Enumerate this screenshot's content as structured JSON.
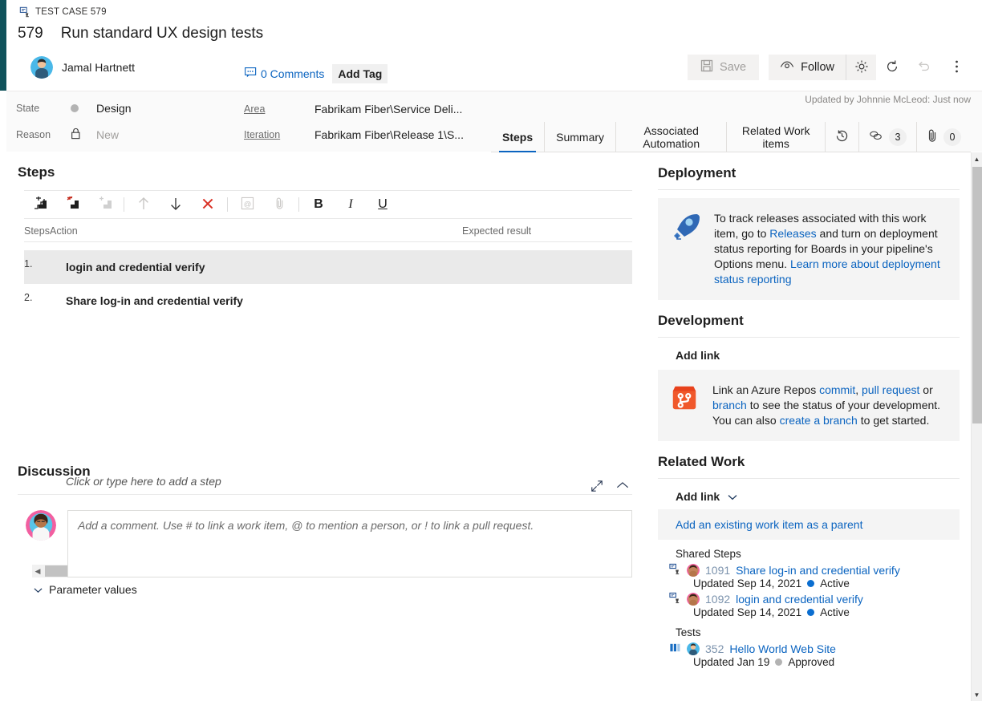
{
  "header": {
    "breadcrumb": "TEST CASE 579",
    "breadcrumb_icon": "test-case-icon",
    "work_item_id": "579",
    "work_item_title": "Run standard UX design tests",
    "assigned_to": "Jamal Hartnett",
    "comments_label": "0 Comments",
    "add_tag_label": "Add Tag",
    "save_label": "Save",
    "follow_label": "Follow",
    "updated_note": "Updated by Johnnie McLeod: Just now",
    "accent_color": "#10525b",
    "link_color": "#0b64c0"
  },
  "fields": {
    "state_label": "State",
    "state_value": "Design",
    "reason_label": "Reason",
    "reason_value": "New",
    "area_label": "Area",
    "area_value": "Fabrikam Fiber\\Service Deli...",
    "iteration_label": "Iteration",
    "iteration_value": "Fabrikam Fiber\\Release 1\\S..."
  },
  "tabs": {
    "items": [
      {
        "label": "Steps",
        "active": true
      },
      {
        "label": "Summary",
        "active": false
      },
      {
        "label": "Associated Automation",
        "active": false
      },
      {
        "label": "Related Work items",
        "active": false
      }
    ],
    "history_icon": "history-icon",
    "links_icon": "links-icon",
    "links_count": "3",
    "attachments_icon": "paperclip-icon",
    "attachments_count": "0"
  },
  "steps": {
    "title": "Steps",
    "toolbar": [
      {
        "name": "insert-step-icon",
        "enabled": true
      },
      {
        "name": "insert-shared-step-icon",
        "enabled": true
      },
      {
        "name": "insert-parameter-icon",
        "enabled": false
      },
      {
        "name": "move-up-icon",
        "enabled": false
      },
      {
        "name": "move-down-icon",
        "enabled": true
      },
      {
        "name": "delete-icon",
        "enabled": true
      },
      {
        "name": "mention-icon",
        "enabled": false
      },
      {
        "name": "attach-icon",
        "enabled": false
      },
      {
        "name": "bold-icon",
        "enabled": true
      },
      {
        "name": "italic-icon",
        "enabled": true
      },
      {
        "name": "underline-icon",
        "enabled": true
      }
    ],
    "bold_label": "B",
    "italic_label": "I",
    "underline_label": "U",
    "columns": {
      "steps": "Steps",
      "action": "Action",
      "expected": "Expected result"
    },
    "rows": [
      {
        "num": "1.",
        "action": "login and credential verify",
        "expected": "",
        "selected": true
      },
      {
        "num": "2.",
        "action": "Share log-in and credential verify",
        "expected": "",
        "selected": false
      }
    ],
    "add_step_hint": "Click or type here to add a step",
    "parameter_values_label": "Parameter values"
  },
  "discussion": {
    "title": "Discussion",
    "comment_placeholder": "Add a comment. Use # to link a work item, @ to mention a person, or ! to link a pull request.",
    "expand_icon": "expand-icon",
    "collapse_icon": "chevron-up-icon"
  },
  "deployment": {
    "title": "Deployment",
    "icon": "rocket-icon",
    "text_1": "To track releases associated with this work item, go to ",
    "link_1": "Releases",
    "text_2": " and turn on deployment status reporting for Boards in your pipeline's Options menu. ",
    "link_2": "Learn more about deployment status reporting"
  },
  "development": {
    "title": "Development",
    "add_link_label": "Add link",
    "icon": "repos-branch-icon",
    "text_1": "Link an Azure Repos ",
    "link_1": "commit",
    "text_2": ", ",
    "link_2": "pull request",
    "text_3": " or ",
    "link_3": "branch",
    "text_4": " to see the status of your development. You can also ",
    "link_4": "create a branch",
    "text_5": " to get started."
  },
  "related_work": {
    "title": "Related Work",
    "add_link_label": "Add link",
    "add_parent_label": "Add an existing work item as a parent",
    "groups": [
      {
        "label": "Shared Steps",
        "items": [
          {
            "icon": "shared-steps-icon",
            "id": "1091",
            "title": "Share log-in and credential verify",
            "updated": "Updated Sep 14, 2021",
            "status": "Active",
            "status_color": "#0b6ed0"
          },
          {
            "icon": "shared-steps-icon",
            "id": "1092",
            "title": "login and credential verify",
            "updated": "Updated Sep 14, 2021",
            "status": "Active",
            "status_color": "#0b6ed0"
          }
        ]
      },
      {
        "label": "Tests",
        "items": [
          {
            "icon": "test-suite-icon",
            "id": "352",
            "title": "Hello World Web Site",
            "updated": "Updated Jan 19",
            "status": "Approved",
            "status_color": "#b3b3b3"
          }
        ]
      }
    ]
  }
}
